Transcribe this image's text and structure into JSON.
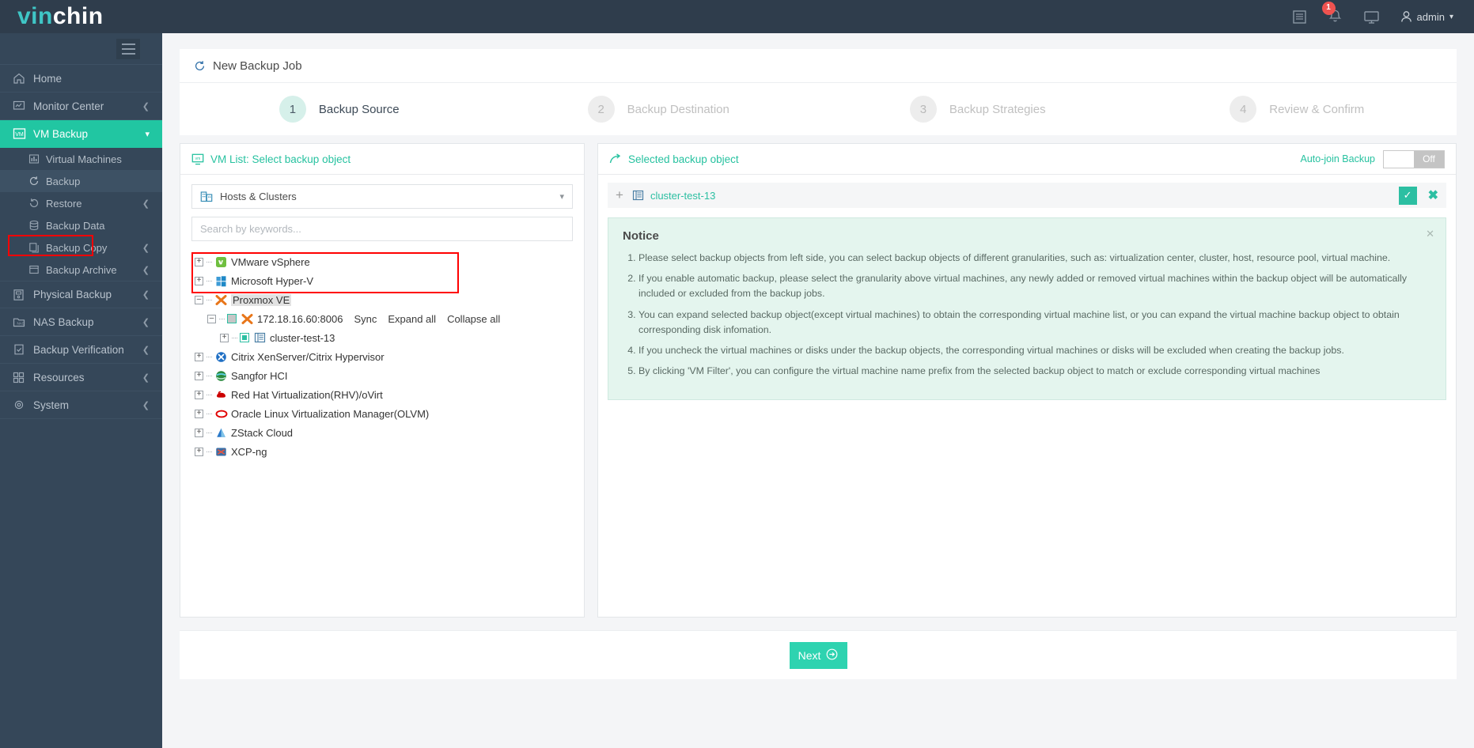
{
  "brand": {
    "part1": "vin",
    "part2": "chin"
  },
  "header": {
    "icons": [
      {
        "name": "logs-icon",
        "glyph": "list"
      },
      {
        "name": "notification-bell-icon",
        "glyph": "bell",
        "badge": "1"
      },
      {
        "name": "console-monitor-icon",
        "glyph": "monitor"
      }
    ],
    "user_label": "admin"
  },
  "sidebar": {
    "items": [
      {
        "label": "Home",
        "icon": "home-icon",
        "caret": false,
        "active": false
      },
      {
        "label": "Monitor Center",
        "icon": "monitor-center-icon",
        "caret": true,
        "active": false
      },
      {
        "label": "VM Backup",
        "icon": "vm-backup-icon",
        "caret": true,
        "active": true,
        "expanded": true
      }
    ],
    "vm_backup_children": [
      {
        "label": "Virtual Machines",
        "icon": "virtual-machines-icon",
        "caret": false,
        "current": false
      },
      {
        "label": "Backup",
        "icon": "backup-refresh-icon",
        "caret": false,
        "current": true
      },
      {
        "label": "Restore",
        "icon": "restore-icon",
        "caret": true,
        "current": false
      },
      {
        "label": "Backup Data",
        "icon": "database-icon",
        "caret": false,
        "current": false
      },
      {
        "label": "Backup Copy",
        "icon": "copy-icon",
        "caret": true,
        "current": false
      },
      {
        "label": "Backup Archive",
        "icon": "archive-icon",
        "caret": true,
        "current": false
      }
    ],
    "items_bottom": [
      {
        "label": "Physical Backup",
        "icon": "physical-backup-icon",
        "caret": true
      },
      {
        "label": "NAS Backup",
        "icon": "nas-backup-icon",
        "caret": true
      },
      {
        "label": "Backup Verification",
        "icon": "backup-verification-icon",
        "caret": true
      },
      {
        "label": "Resources",
        "icon": "resources-icon",
        "caret": true
      },
      {
        "label": "System",
        "icon": "system-gear-icon",
        "caret": true
      }
    ]
  },
  "page": {
    "title": "New Backup Job"
  },
  "wizard": {
    "steps": [
      {
        "number": "1",
        "label": "Backup Source",
        "active": true
      },
      {
        "number": "2",
        "label": "Backup Destination",
        "active": false
      },
      {
        "number": "3",
        "label": "Backup Strategies",
        "active": false
      },
      {
        "number": "4",
        "label": "Review & Confirm",
        "active": false
      }
    ]
  },
  "left_panel": {
    "title": "VM List: Select backup object",
    "view_selector": "Hosts & Clusters",
    "search_placeholder": "Search by keywords...",
    "tree": [
      {
        "label": "VMware vSphere",
        "icon": "vmware-icon",
        "state": "collapsed",
        "level": 0
      },
      {
        "label": "Microsoft Hyper-V",
        "icon": "hyperv-icon",
        "state": "collapsed",
        "level": 0
      },
      {
        "label": "Proxmox VE",
        "icon": "proxmox-icon",
        "state": "expanded",
        "level": 0,
        "selected": true
      },
      {
        "label": "172.18.16.60:8006",
        "icon": "proxmox-icon",
        "state": "expanded",
        "level": 1,
        "checkbox": "partial",
        "links": [
          "Sync",
          "Expand all",
          "Collapse all"
        ]
      },
      {
        "label": "cluster-test-13",
        "icon": "cluster-icon",
        "state": "collapsed",
        "level": 2,
        "checkbox": "checked"
      },
      {
        "label": "Citrix XenServer/Citrix Hypervisor",
        "icon": "citrix-icon",
        "state": "collapsed",
        "level": 0
      },
      {
        "label": "Sangfor HCI",
        "icon": "sangfor-icon",
        "state": "collapsed",
        "level": 0
      },
      {
        "label": "Red Hat Virtualization(RHV)/oVirt",
        "icon": "redhat-icon",
        "state": "collapsed",
        "level": 0
      },
      {
        "label": "Oracle Linux Virtualization Manager(OLVM)",
        "icon": "oracle-icon",
        "state": "collapsed",
        "level": 0
      },
      {
        "label": "ZStack Cloud",
        "icon": "zstack-icon",
        "state": "collapsed",
        "level": 0
      },
      {
        "label": "XCP-ng",
        "icon": "xcpng-icon",
        "state": "collapsed",
        "level": 0
      }
    ]
  },
  "right_panel": {
    "title": "Selected backup object",
    "auto_join_label": "Auto-join Backup",
    "auto_join_state": "Off",
    "selected_object": "cluster-test-13",
    "notice": {
      "title": "Notice",
      "items": [
        "Please select backup objects from left side, you can select backup objects of different granularities, such as: virtualization center, cluster, host, resource pool, virtual machine.",
        "If you enable automatic backup, please select the granularity above virtual machines, any newly added or removed virtual machines within the backup object will be automatically included or excluded from the backup jobs.",
        "You can expand selected backup object(except virtual machines) to obtain the corresponding virtual machine list, or you can expand the virtual machine backup object to obtain corresponding disk infomation.",
        "If you uncheck the virtual machines or disks under the backup objects, the corresponding virtual machines or disks will be excluded when creating the backup jobs.",
        "By clicking 'VM Filter', you can configure the virtual machine name prefix from the selected backup object to match or exclude corresponding virtual machines"
      ]
    }
  },
  "footer": {
    "next_label": "Next"
  },
  "colors": {
    "brand_teal": "#22c6a0",
    "sidebar_bg": "#354759",
    "topbar_bg": "#2f3d4c",
    "notice_bg": "#e4f5ee",
    "highlight_red": "#ff0000",
    "badge_red": "#ef5350"
  }
}
